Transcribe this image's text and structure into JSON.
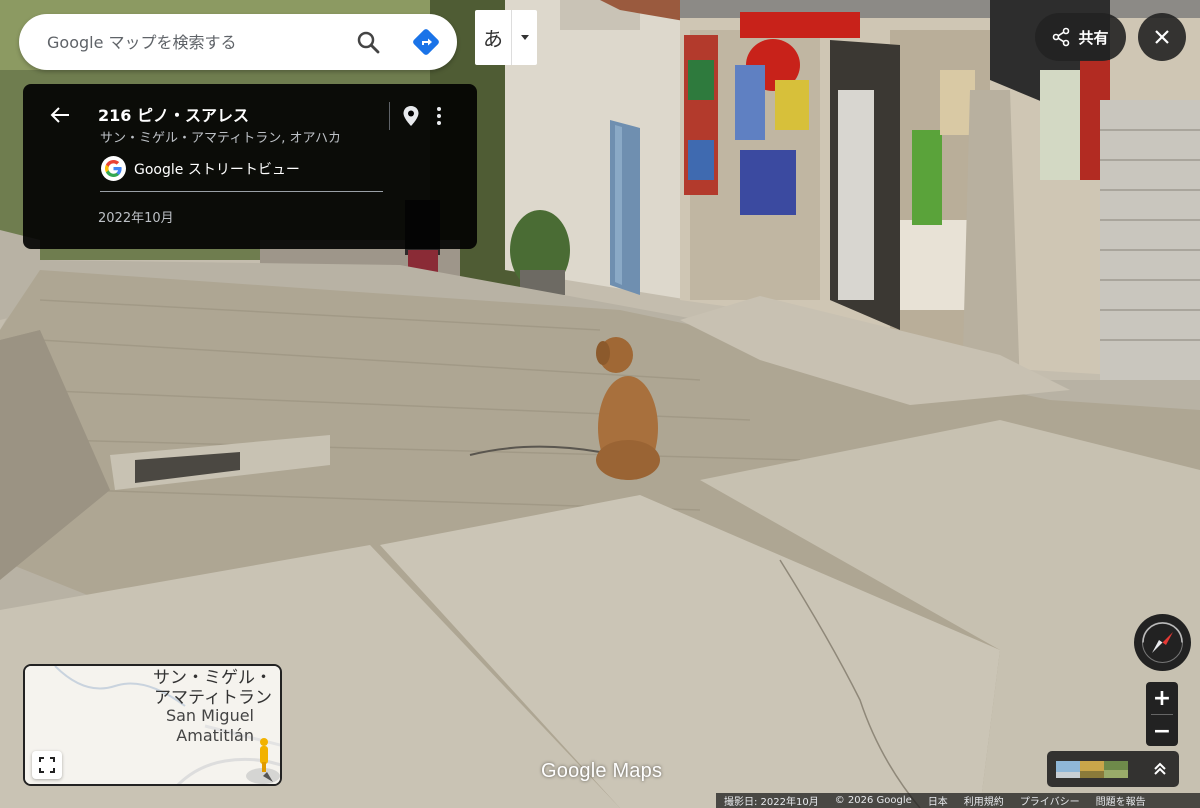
{
  "search": {
    "placeholder": "Google マップを検索する",
    "search_icon": "search-icon",
    "directions_icon": "directions-icon"
  },
  "ime": {
    "char": "あ"
  },
  "card": {
    "title": "216 ピノ・スアレス",
    "subtitle": "サン・ミゲル・アマティトラン, オアハカ",
    "streetview_label": "Google ストリートビュー",
    "date": "2022年10月"
  },
  "share": {
    "label": "共有"
  },
  "zoom": {
    "in": "+",
    "out": "−"
  },
  "minimap": {
    "label_jp_1": "サン・ミゲル・",
    "label_jp_2": "アマティトラン",
    "label_en_1": "San Miguel",
    "label_en_2": "Amatitlán"
  },
  "watermark": "Google Maps",
  "footer": {
    "capture": "撮影日: 2022年10月",
    "copyright": "© 2026 Google",
    "country": "日本",
    "terms": "利用規約",
    "privacy": "プライバシー",
    "report": "問題を報告"
  },
  "colors": {
    "directions": "#1a73e8",
    "card_bg": "#000000",
    "control_bg": "#222222"
  }
}
